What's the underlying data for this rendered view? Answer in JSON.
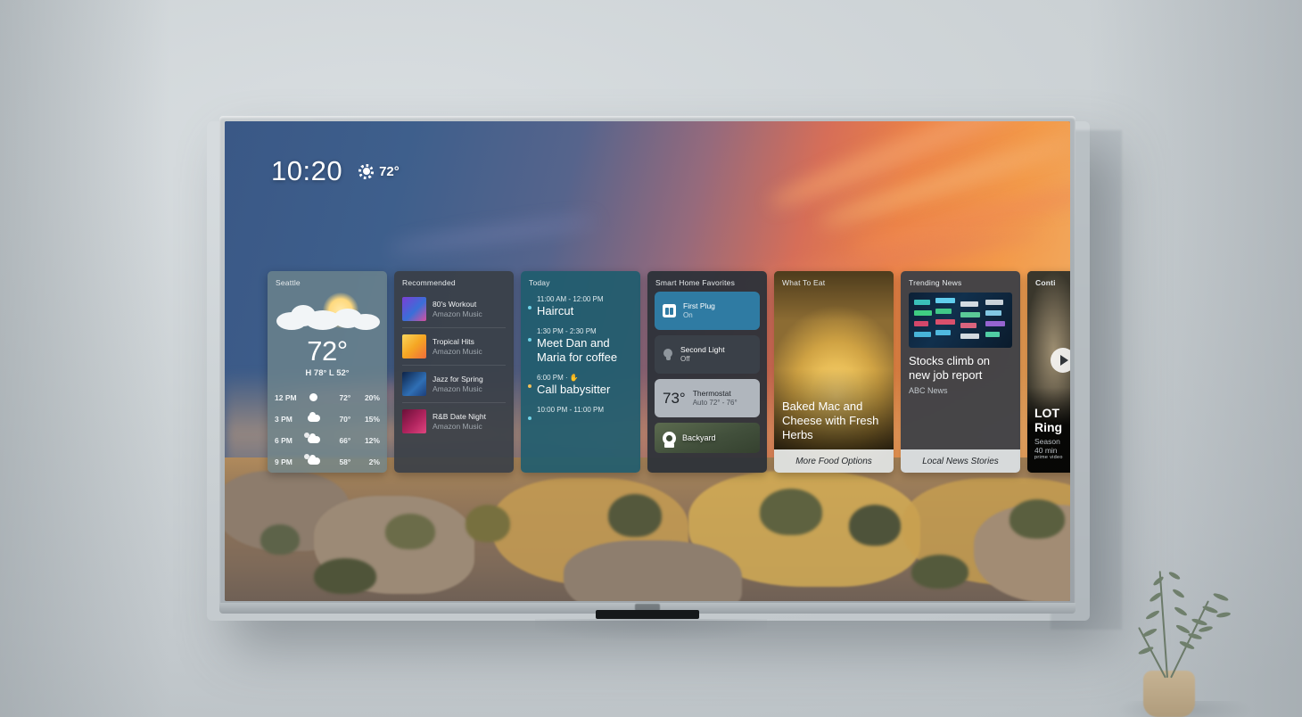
{
  "scene": {
    "description": "Wall-mounted Fire TV showing ambient home screen with widget row over a desert sunset wallpaper"
  },
  "status_bar": {
    "clock": "10:20",
    "weather_icon": "sun-icon",
    "temperature": "72°"
  },
  "widgets": [
    {
      "type": "weather",
      "title": "Seattle",
      "icon": "partly-cloudy-sun-icon",
      "current_temp": "72°",
      "high_low": "H 78° L 52°",
      "hourly": [
        {
          "time": "12 PM",
          "icon": "sun-icon",
          "temp": "72°",
          "precip": "20%"
        },
        {
          "time": "3 PM",
          "icon": "cloud-icon",
          "temp": "70°",
          "precip": "15%"
        },
        {
          "time": "6 PM",
          "icon": "partly-cloudy-icon",
          "temp": "66°",
          "precip": "12%"
        },
        {
          "time": "9 PM",
          "icon": "partly-cloudy-icon",
          "temp": "58°",
          "precip": "2%"
        }
      ]
    },
    {
      "type": "recommended",
      "title": "Recommended",
      "items": [
        {
          "name": "80's Workout",
          "source": "Amazon Music",
          "art_colors": [
            "#7b3fd4",
            "#3a6fd8",
            "#d84fa0"
          ]
        },
        {
          "name": "Tropical Hits",
          "source": "Amazon Music",
          "art_colors": [
            "#f5a623",
            "#f06d3a",
            "#f9d65c"
          ]
        },
        {
          "name": "Jazz for Spring",
          "source": "Amazon Music",
          "art_colors": [
            "#1d3f7a",
            "#2f6fb5",
            "#0e2347"
          ]
        },
        {
          "name": "R&B Date Night",
          "source": "Amazon Music",
          "art_colors": [
            "#b0245e",
            "#e0457f",
            "#6a1038"
          ]
        }
      ]
    },
    {
      "type": "calendar",
      "title": "Today",
      "events": [
        {
          "time": "11:00 AM - 12:00 PM",
          "name": "Haircut",
          "dot_color": "#6fd3e8",
          "has_reminder": false
        },
        {
          "time": "1:30 PM - 2:30 PM",
          "name": "Meet Dan and Maria for coffee",
          "dot_color": "#6fd3e8",
          "has_reminder": false
        },
        {
          "time": "6:00 PM",
          "name": "Call babysitter",
          "dot_color": "#f0c05a",
          "has_reminder": true
        },
        {
          "time": "10:00 PM - 11:00 PM",
          "name": "",
          "dot_color": "#6fd3e8",
          "has_reminder": false
        }
      ]
    },
    {
      "type": "smart_home",
      "title": "Smart Home Favorites",
      "devices": [
        {
          "name": "First Plug",
          "state": "On",
          "icon": "outlet-icon",
          "active": true
        },
        {
          "name": "Second Light",
          "state": "Off",
          "icon": "lightbulb-icon",
          "active": false
        },
        {
          "name": "Thermostat",
          "state": "Auto 72° - 76°",
          "icon": "thermostat-icon",
          "value": "73°",
          "active": false
        }
      ],
      "camera": {
        "name": "Backyard",
        "icon": "camera-icon"
      }
    },
    {
      "type": "food",
      "title": "What To Eat",
      "headline": "Baked Mac and Cheese with Fresh Herbs",
      "footer": "More Food Options"
    },
    {
      "type": "news",
      "title": "Trending News",
      "headline": "Stocks climb on new job report",
      "source": "ABC News",
      "footer": "Local News Stories"
    },
    {
      "type": "continue_watching",
      "title": "Conti",
      "headline_line1": "LOT",
      "headline_line2": "Ring",
      "subtitle": "Season",
      "duration": "40 min",
      "provider": "prime video",
      "play_icon": "play-icon"
    }
  ],
  "colors": {
    "accent_blue": "#2f7ba3",
    "calendar_bg": "#1f5c6e",
    "card_dark": "#3a3f46",
    "thermostat_bg": "#b0b6bd"
  }
}
